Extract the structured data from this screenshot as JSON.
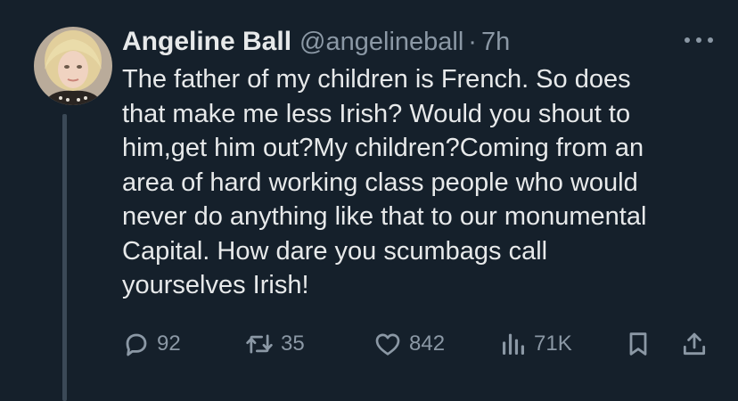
{
  "tweet": {
    "author_name": "Angeline Ball",
    "handle": "@angelineball",
    "separator": "·",
    "time": "7h",
    "text": "The father of my children is French. So does\nthat make me less Irish? Would you shout to\nhim,get him out?My children?Coming from an\narea of hard working class people who would\nnever do anything like that to our monumental\nCapital. How dare you scumbags call\nyourselves Irish!"
  },
  "actions": {
    "replies": "92",
    "retweets": "35",
    "likes": "842",
    "views": "71K"
  },
  "icons": {
    "reply": "reply-icon",
    "retweet": "retweet-icon",
    "like": "heart-icon",
    "views": "views-chart-icon",
    "bookmark": "bookmark-icon",
    "share": "share-icon",
    "more": "more-icon"
  },
  "colors": {
    "background": "#15202b",
    "text_primary": "#e7e9ea",
    "text_secondary": "#8b98a5"
  }
}
